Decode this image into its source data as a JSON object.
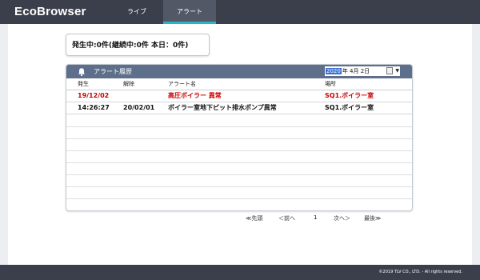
{
  "app": {
    "logo": "EcoBrowser"
  },
  "nav": {
    "tabs": [
      {
        "label": "ライブ"
      },
      {
        "label": "アラート"
      }
    ]
  },
  "summary": {
    "text": "発生中:0件(継続中:0件 本日：0件)"
  },
  "panel": {
    "title": "アラート履歴",
    "date": {
      "year": "2020",
      "rest": "年  4月  2日"
    },
    "columns": [
      "発生",
      "解除",
      "アラート名",
      "場所"
    ],
    "rows": [
      {
        "occurred": "19/12/02",
        "cleared": "",
        "name": "高圧ボイラー 異常",
        "location": "SQ1.ボイラー室",
        "color": "#c80000"
      },
      {
        "occurred": "14:26:27",
        "cleared": "20/02/01",
        "name": "ボイラー室地下ピット排水ポンプ異常",
        "location": "SQ1.ボイラー室",
        "color": "#111111"
      }
    ]
  },
  "pager": {
    "first": "≪先頭",
    "prev": "＜前へ",
    "page": "1",
    "next": "次へ＞",
    "last": "最後≫"
  },
  "footer": {
    "copyright": "©2019 TLV CO., LTD.   - All rights reserved."
  },
  "colors": {
    "topbar": "#3a3f4b",
    "active_tab_underline": "#2bb5c4",
    "panel_header": "#5d6f8a",
    "alert_red": "#c80000"
  }
}
